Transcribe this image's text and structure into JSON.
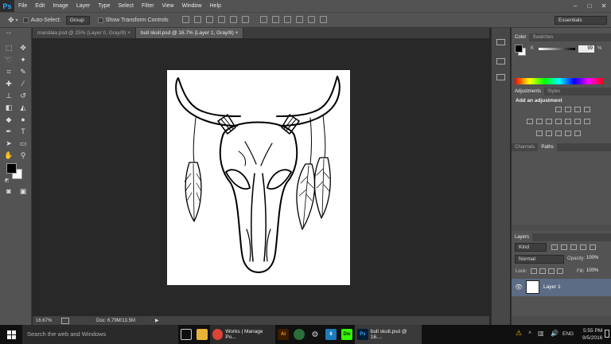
{
  "menu": {
    "logo": "Ps",
    "items": [
      "File",
      "Edit",
      "Image",
      "Layer",
      "Type",
      "Select",
      "Filter",
      "View",
      "Window",
      "Help"
    ],
    "window_controls": [
      "–",
      "□",
      "✕"
    ]
  },
  "options_bar": {
    "auto_select_label": "Auto-Select:",
    "auto_select_value": "Group",
    "transform_label": "Show Transform Controls",
    "workspace": "Essentials"
  },
  "tabs": [
    {
      "label": "mandala.psd @ 25% (Layer 0, Gray/8)",
      "close": "×",
      "active": false
    },
    {
      "label": "bull skull.psd @ 16.7% (Layer 1, Gray/8)",
      "close": "×",
      "active": true
    }
  ],
  "status": {
    "zoom": "16.67%",
    "doc": "Doc: 6.79M/13.5M",
    "arrow": "▶"
  },
  "color_panel": {
    "tabs": [
      "Color",
      "Swatches"
    ],
    "channel": "K",
    "value": "99",
    "unit": "%"
  },
  "adjustments_panel": {
    "tabs": [
      "Adjustments",
      "Styles"
    ],
    "heading": "Add an adjustment"
  },
  "paths_panel": {
    "tabs": [
      "Channels",
      "Paths"
    ]
  },
  "layers_panel": {
    "tabs": [
      "Layers"
    ],
    "kind": "Kind",
    "blend_mode": "Normal",
    "opacity_label": "Opacity:",
    "opacity_value": "100%",
    "lock_label": "Lock:",
    "fill_label": "Fill:",
    "fill_value": "100%",
    "layers": [
      {
        "name": "Layer 1",
        "visible": true,
        "selected": true
      }
    ]
  },
  "taskbar": {
    "search_placeholder": "Search the web and Windows",
    "apps": [
      {
        "name": "Works | Manage Po...",
        "icon": "chrome-icon"
      },
      {
        "name": "bull skull.psd @ 16....",
        "icon": "photoshop-icon"
      }
    ],
    "lang": "ENG",
    "time": "5:55 PM",
    "date": "9/5/2016"
  },
  "colors": {
    "ps_blue": "#31a8ff",
    "panel_bg": "#535353",
    "canvas_bg": "#282828",
    "selected_layer": "#5b6c84"
  }
}
